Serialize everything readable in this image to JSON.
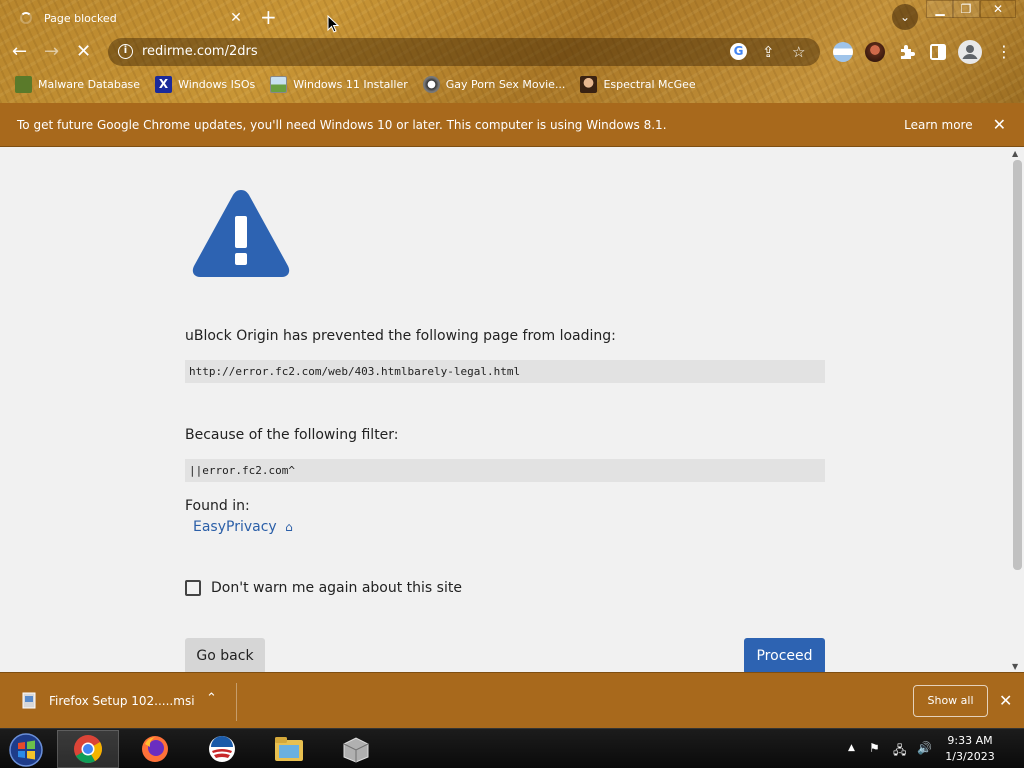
{
  "browser": {
    "tab_title": "Page blocked",
    "url": "redirme.com/2drs",
    "bookmarks": [
      {
        "label": "Malware Database",
        "icon": "malware-db-icon"
      },
      {
        "label": "Windows ISOs",
        "icon": "windows-x-icon"
      },
      {
        "label": "Windows 11 Installer",
        "icon": "image-icon"
      },
      {
        "label": "Gay Porn Sex Movie...",
        "icon": "site-icon"
      },
      {
        "label": "Espectral McGee",
        "icon": "avatar-icon"
      }
    ]
  },
  "infobar": {
    "text": "To get future Google Chrome updates, you'll need Windows 10 or later. This computer is using Windows 8.1.",
    "link": "Learn more"
  },
  "blocked_page": {
    "intro": "uBlock Origin has prevented the following page from loading:",
    "blocked_url": "http://error.fc2.com/web/403.htmlbarely-legal.html",
    "filter_heading": "Because of the following filter:",
    "filter": "||error.fc2.com^",
    "found_in": "Found in:",
    "filter_list": "EasyPrivacy",
    "checkbox_label": "Don't warn me again about this site",
    "back_label": "Go back",
    "proceed_label": "Proceed",
    "accent_color": "#2d63b2"
  },
  "downloads": {
    "file_name": "Firefox Setup 102.....msi",
    "show_all": "Show all"
  },
  "taskbar": {
    "time": "9:33 AM",
    "date": "1/3/2023"
  }
}
